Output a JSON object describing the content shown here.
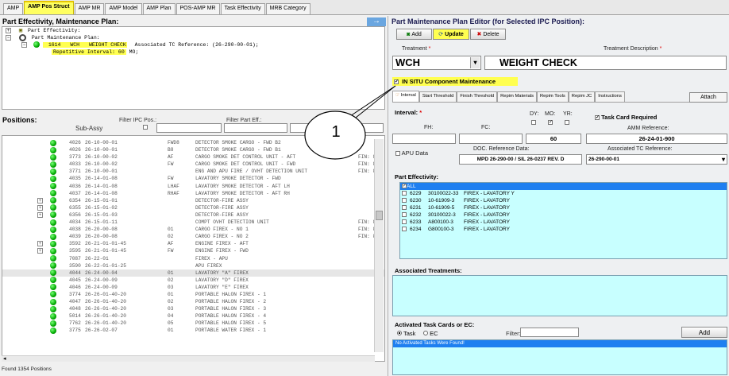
{
  "tabs": [
    "AMP",
    "AMP Pos Struct",
    "AMP MR",
    "AMP Model",
    "AMP Plan",
    "POS-AMP MR",
    "Task Effectivity",
    "MRB Category"
  ],
  "left": {
    "title": "Part Effectivity, Maintenance Plan:",
    "tree": {
      "node1": "Part Effectivity:",
      "node2": "Part Maintenance Plan:",
      "node3_code": "1614",
      "node3_task": "WCH",
      "node3_desc": "WEIGHT CHECK",
      "node3_ref": "Associated TC Reference: (26-290-00-01);",
      "node4": "Repetitive Interval:",
      "node4_val": "60",
      "node4_unit": "MO;"
    },
    "positions_title": "Positions:",
    "sub_assy_label": "Sub-Assy",
    "filter_ipc_label": "Filter IPC Pos.:",
    "filter_part_label": "Filter Part Eff.:",
    "rows": [
      [
        "4026",
        "26-10-00-01",
        "FWD8",
        "DETECTOR SMOKE CARGO - FWD B2",
        ""
      ],
      [
        "4026",
        "26-10-00-01",
        "B8",
        "DETECTOR SMOKE CARGO - FWD B1",
        ""
      ],
      [
        "3773",
        "26-10-00-02",
        "AF",
        "CARGO SMOKE DET CONTROL UNIT - AFT",
        "FIN: 8G2"
      ],
      [
        "4033",
        "26-10-00-02",
        "FW",
        "CARGO SMOKE DET CONTROL UNIT - FWD",
        "FIN: 8G2"
      ],
      [
        "3771",
        "26-10-00-01",
        "",
        "ENG AND APU FIRE / OVHT DETECTION UNIT",
        "FIN: 80C"
      ],
      [
        "4035",
        "26-14-01-08",
        "FW",
        "LAVATORY SMOKE DETECTOR - FWD",
        ""
      ],
      [
        "4036",
        "26-14-01-08",
        "LHAF",
        "LAVATORY SMOKE DETECTOR - AFT LH",
        ""
      ],
      [
        "4037",
        "26-14-01-08",
        "RHAF",
        "LAVATORY SMOKE DETECTOR - AFT RH",
        ""
      ],
      [
        "6354",
        "26-15-01-01",
        "",
        "DETECTOR-FIRE ASSY",
        ""
      ],
      [
        "6355",
        "26-15-01-02",
        "",
        "DETECTOR-FIRE ASSY",
        ""
      ],
      [
        "6356",
        "26-15-01-03",
        "",
        "DETECTOR-FIRE ASSY",
        ""
      ],
      [
        "4034",
        "26-15-01-11",
        "",
        "COMPT OVHT DETECTION UNIT",
        "FIN: 80C"
      ],
      [
        "4038",
        "26-20-00-08",
        "01",
        "CARGO FIREX - NO 1",
        "FIN: 8G2"
      ],
      [
        "4039",
        "26-20-00-08",
        "02",
        "CARGO FIREX - NO 2",
        "FIN: 8G2"
      ],
      [
        "3592",
        "26-21-01-01-45",
        "AF",
        "ENGINE FIREX - AFT",
        ""
      ],
      [
        "3595",
        "26-21-01-01-45",
        "FW",
        "ENGINE FIREX - FWD",
        ""
      ],
      [
        "7087",
        "26-22-01",
        "",
        "FIREX - APU",
        ""
      ],
      [
        "3590",
        "26-22-01-01-25",
        "",
        "APU FIREX",
        ""
      ],
      [
        "4044",
        "26-24-00-04",
        "01",
        "LAVATORY \"A\" FIREX",
        ""
      ],
      [
        "4045",
        "26-24-00-09",
        "02",
        "LAVATORY \"D\" FIREX",
        ""
      ],
      [
        "4046",
        "26-24-00-09",
        "03",
        "LAVATORY \"E\" FIREX",
        ""
      ],
      [
        "3774",
        "26-26-01-40-20",
        "01",
        "PORTABLE HALON FIREX - 1",
        ""
      ],
      [
        "4047",
        "26-26-01-40-20",
        "02",
        "PORTABLE HALON FIREX - 2",
        ""
      ],
      [
        "4048",
        "26-26-01-40-20",
        "03",
        "PORTABLE HALON FIREX - 3",
        ""
      ],
      [
        "5014",
        "26-26-01-40-20",
        "04",
        "PORTABLE HALON FIREX - 4",
        ""
      ],
      [
        "7762",
        "26-26-01-40-20",
        "05",
        "PORTABLE HALON FIREX - 5",
        ""
      ],
      [
        "3775",
        "26-26-02-07",
        "01",
        "PORTABLE WATER FIREX - 1",
        ""
      ]
    ],
    "status": "Found 1354 Positions"
  },
  "right": {
    "title": "Part Maintenance Plan Editor (for Selected IPC Position):",
    "add_label": "Add",
    "update_label": "Update",
    "delete_label": "Delete",
    "treatment_label": "Treatment",
    "treatment_desc_label": "Treatment Description",
    "required_mark": "*",
    "treatment_value": "WCH",
    "treatment_desc_value": "WEIGHT CHECK",
    "insitu_label": "IN SITU Component Maintenance",
    "subtabs": [
      "Interval",
      "Start Threshold",
      "Finish Threshold",
      "Repim Materials",
      "Repim Tools",
      "Repim JC",
      "Instructions"
    ],
    "attach_label": "Attach",
    "interval_label": "Interval:",
    "dy_label": "DY:",
    "mo_label": "MO:",
    "yr_label": "YR:",
    "task_card_label": "Task Card Required",
    "fh_label": "FH:",
    "fc_label": "FC:",
    "interval_value": "60",
    "amm_ref_label": "AMM Reference:",
    "amm_ref_value": "26-24-01-900",
    "apu_label": "APU Data",
    "doc_ref_label": "DOC. Reference Data:",
    "doc_ref_value": "MPD 26-290-00 / SIL 26-0237 REV. D",
    "assoc_tc_label": "Associated TC Reference:",
    "assoc_tc_value": "26-290-00-01",
    "part_eff_label": "Part Effectivity:",
    "part_eff_all": "ALL",
    "part_eff": [
      [
        "6229",
        "30100022-33",
        "FIREX - LAVATORY Y"
      ],
      [
        "6230",
        "10-61909-3",
        "FIREX - LAVATORY"
      ],
      [
        "6231",
        "10-61909-5",
        "FIREX - LAVATORY"
      ],
      [
        "6232",
        "30100022-3",
        "FIREX - LAVATORY"
      ],
      [
        "6233",
        "A800100-3",
        "FIREX - LAVATORY"
      ],
      [
        "6234",
        "G800100-3",
        "FIREX - LAVATORY"
      ]
    ],
    "assoc_treat_label": "Associated Treatments:",
    "activated_label": "Activated Task Cards or EC:",
    "task_radio": "Task",
    "ec_radio": "EC",
    "filter_label": "Filter:",
    "add2_label": "Add",
    "no_tasks": "No Activated Tasks Were Found!"
  },
  "callout": "1",
  "colors": {
    "highlight": "#ffff50",
    "cyan": "#c8ffff",
    "blue_sel": "#1e7ff0"
  }
}
